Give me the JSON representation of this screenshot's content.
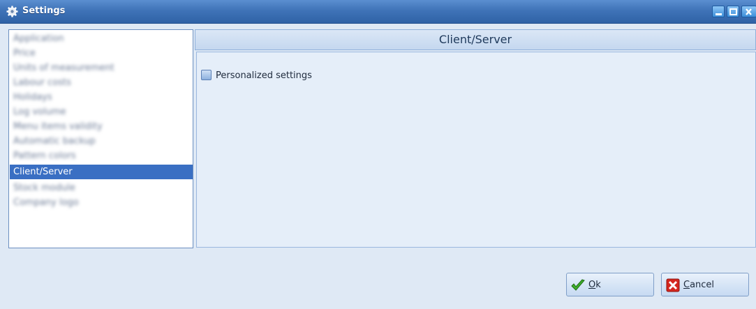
{
  "window": {
    "title": "Settings",
    "icon": "gear-icon",
    "controls": [
      "minimize-icon",
      "maximize-icon",
      "close-icon"
    ]
  },
  "sidebar": {
    "items": [
      {
        "label": "Application",
        "blurred": true
      },
      {
        "label": "Price",
        "blurred": true
      },
      {
        "label": "Units of measurement",
        "blurred": true
      },
      {
        "label": "Labour costs",
        "blurred": true
      },
      {
        "label": "Holidays",
        "blurred": true
      },
      {
        "label": "Log volume",
        "blurred": true
      },
      {
        "label": "Menu items validity",
        "blurred": true
      },
      {
        "label": "Automatic backup",
        "blurred": true
      },
      {
        "label": "Pattern colors",
        "blurred": true
      },
      {
        "label": "Client/Server",
        "blurred": false,
        "selected": true
      },
      {
        "label": "Stock module",
        "blurred": true
      },
      {
        "label": "Company logo",
        "blurred": true
      }
    ]
  },
  "main": {
    "header": "Client/Server",
    "checkbox": {
      "label": "Personalized settings",
      "checked": false
    }
  },
  "buttons": {
    "ok": {
      "label_prefix": "",
      "accel": "O",
      "label_rest": "k",
      "icon": "checkmark-icon"
    },
    "cancel": {
      "label_prefix": "",
      "accel": "C",
      "label_rest": "ancel",
      "icon": "cancel-x-icon"
    }
  },
  "colors": {
    "title_bar": "#3f73b8",
    "selection": "#3a6fc3",
    "panel_bg": "#dfe9f5"
  }
}
